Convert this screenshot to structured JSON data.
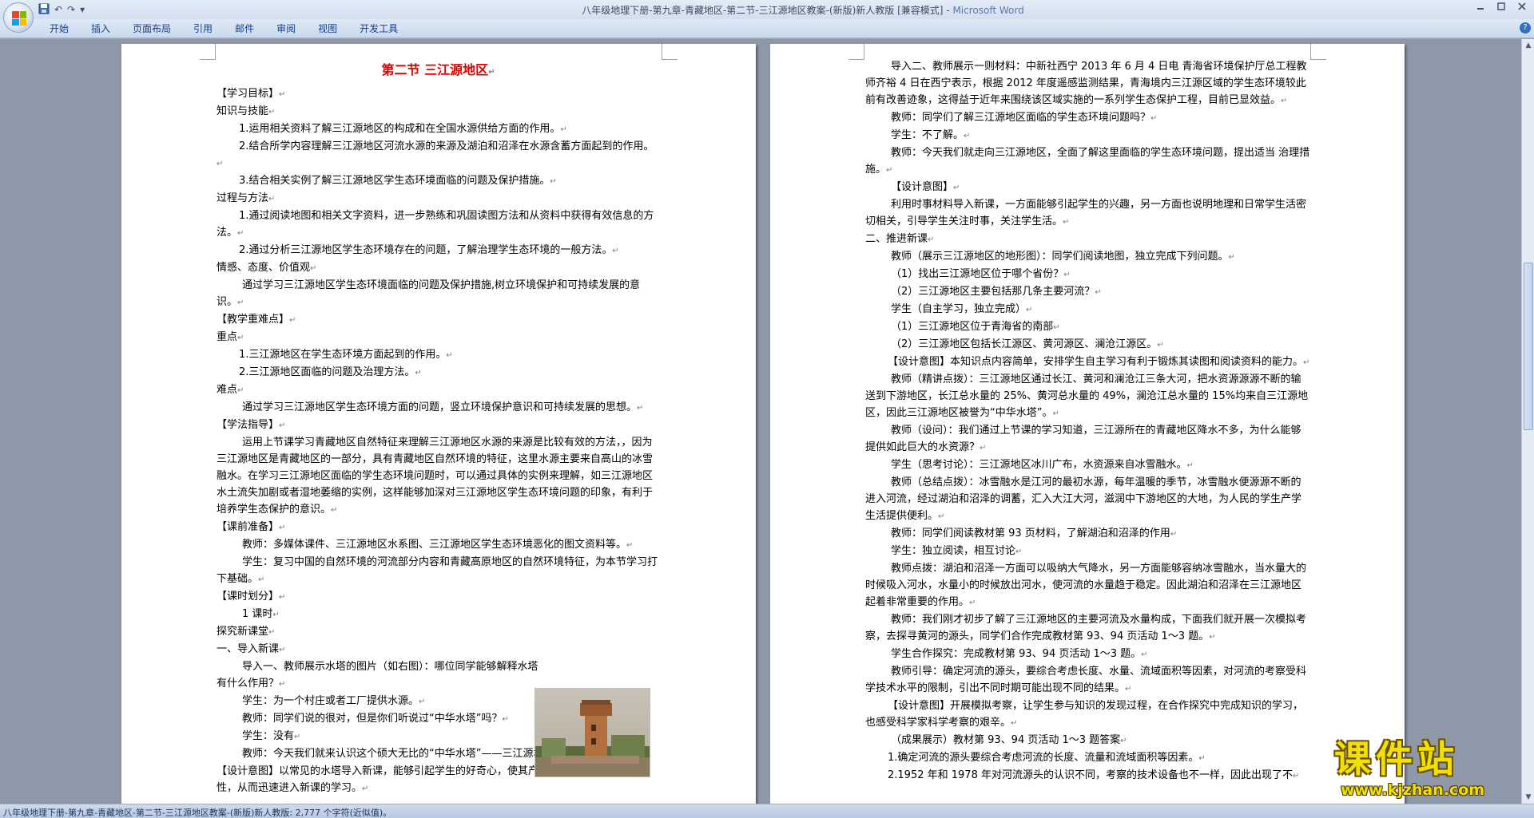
{
  "window": {
    "title_doc": "八年级地理下册-第九章-青藏地区-第二节-三江源地区教案-(新版)新人教版 [兼容模式] - ",
    "title_app": "Microsoft Word"
  },
  "qat": {
    "save_icon": "save-icon",
    "undo_label": "↶",
    "redo_label": "↷",
    "menu_label": "▾"
  },
  "ribbon": {
    "tabs": [
      "开始",
      "插入",
      "页面布局",
      "引用",
      "邮件",
      "审阅",
      "视图",
      "开发工具"
    ]
  },
  "page1": {
    "title": "第二节  三江源地区",
    "lines": [
      "【学习目标】",
      "知识与技能",
      "1.运用相关资料了解三江源地区的构成和在全国水源供给方面的作用。",
      "2.结合所学内容理解三江源地区河流水源的来源及湖泊和沼泽在水源含蓄方面起到的作用。",
      "3.结合相关实例了解三江源地区学生态环境面临的问题及保护措施。",
      "过程与方法",
      "1.通过阅读地图和相关文字资料，进一步熟练和巩固读图方法和从资料中获得有效信息的方法。",
      "2.通过分析三江源地区学生态环境存在的问题，了解治理学生态环境的一般方法。",
      "情感、态度、价值观",
      "通过学习三江源地区学生态环境面临的问题及保护措施,树立环境保护和可持续发展的意识。",
      "【教学重难点】",
      "重点",
      "1.三江源地区在学生态环境方面起到的作用。",
      "2.三江源地区面临的问题及治理方法。",
      "难点",
      "通过学习三江源地区学生态环境方面的问题，竖立环境保护意识和可持续发展的思想。",
      "【学法指导】",
      "运用上节课学习青藏地区自然特征来理解三江源地区水源的来源是比较有效的方法，，因为三江源地区是青藏地区的一部分，具有青藏地区自然环境的特征，这里水源主要来自高山的冰雪融水。在学习三江源地区面临的学生态环境问题时，可以通过具体的实例来理解，如三江源地区水土流失加剧或者湿地萎缩的实例，这样能够加深对三江源地区学生态环境问题的印象，有利于培养学生态保护的意识。",
      "【课前准备】",
      "教师：多媒体课件、三江源地区水系图、三江源地区学生态环境恶化的图文资料等。",
      "学生：复习中国的自然环境的河流部分内容和青藏高原地区的自然环境特征，为本节学习打下基础。",
      "【课时划分】",
      "1 课时",
      "探究新课堂",
      "一、导入新课",
      "导入一、教师展示水塔的图片（如右图）：哪位同学能够解释水塔有什么作用？",
      "学生：为一个村庄或者工厂提供水源。",
      "教师：同学们说的很对，但是你们听说过“中华水塔”吗？",
      "学生：没有",
      "教师：今天我们就来认识这个硕大无比的“中华水塔”——三江源地区。",
      "【设计意图】以常见的水塔导入新课，能够引起学生的好奇心，使其产学生探索新知识的积极性，从而迅速进入新课的学习。"
    ]
  },
  "page2": {
    "lines": [
      "导入二、教师展示一则材料：中新社西宁 2013 年 6 月 4 日电  青海省环境保护厅总工程教师齐裕 4 日在西宁表示，根据 2012 年度遥感监测结果，青海境内三江源区域的学生态环境较此前有改善迹象，这得益于近年来围绕该区域实施的一系列学生态保护工程，目前已显效益。",
      "教师：同学们了解三江源地区面临的学生态环境问题吗？",
      "学生：不了解。",
      "教师：今天我们就走向三江源地区，全面了解这里面临的学生态环境问题，提出适当 治理措施。",
      "【设计意图】",
      "利用时事材料导入新课，一方面能够引起学生的兴趣，另一方面也说明地理和日常学生活密切相关，引导学生关注时事，关注学生活。",
      "二、推进新课",
      "教师（展示三江源地区的地形图）：同学们阅读地图，独立完成下列问题。",
      "（1）找出三江源地区位于哪个省份？",
      "（2）三江源地区主要包括那几条主要河流？",
      "学生（自主学习，独立完成）",
      "（1）三江源地区位于青海省的南部",
      "（2）三江源地区包括长江源区、黄河源区、澜沧江源区。",
      "【设计意图】本知识点内容简单，安排学生自主学习有利于锻炼其读图和阅读资料的能力。",
      "教师（精讲点拨）：三江源地区通过长江、黄河和澜沧江三条大河，把水资源源源不断的输送到下游地区，长江总水量的 25%、黄河总水量的 49%，澜沧江总水量的 15%均来自三江源地区，因此三江源地区被誉为“中华水塔”。",
      "教师（设问）：我们通过上节课的学习知道，三江源所在的青藏地区降水不多，为什么能够提供如此巨大的水资源？",
      "学生（思考讨论）：三江源地区冰川广布，水资源来自冰雪融水。",
      "教师（总结点拨）：冰雪融水是江河的最初水源，每年温暖的季节，冰雪融水便源源不断的进入河流，经过湖泊和沼泽的调蓄，汇入大江大河，滋润中下游地区的大地，为人民的学生产学生活提供便利。",
      "教师：同学们阅读教材第 93 页材料，了解湖泊和沼泽的作用",
      "学生：独立阅读，相互讨论",
      "教师点拨：湖泊和沼泽一方面可以吸纳大气降水，另一方面能够容纳冰雪融水，当水量大的时候吸入河水，水量小的时候放出河水，使河流的水量趋于稳定。因此湖泊和沼泽在三江源地区起着非常重要的作用。",
      "教师：我们刚才初步了解了三江源地区的主要河流及水量构成，下面我们就开展一次模拟考察，去探寻黄河的源头，同学们合作完成教材第 93、94 页活动 1～3 题。",
      "学生合作探究：完成教材第 93、94 页活动 1～3 题。",
      "教师引导：确定河流的源头，要综合考虑长度、水量、流域面积等因素，对河流的考察受科学技术水平的限制，引出不同时期可能出现不同的结果。",
      "【设计意图】开展模拟考察，让学生参与知识的发现过程，在合作探究中完成知识的学习，也感受科学家科学考察的艰辛。",
      "（成果展示）教材第 93、94 页活动 1～3 题答案",
      "1.确定河流的源头要综合考虑河流的长度、流量和流域面积等因素。",
      "2.1952 年和 1978 年对河流源头的认识不同，考察的技术设备也不一样，因此出现了不"
    ]
  },
  "status": {
    "text": "八年级地理下册-第九章-青藏地区-第二节-三江源地区教案-(新版)新人教版: 2,777 个字符(近似值)。"
  },
  "watermark": {
    "big": "课件站",
    "url": "www.kjzhan.com"
  },
  "colors": {
    "title_red": "#e00000",
    "ribbon_text": "#15428b",
    "watermark_yellow": "#f2e100"
  }
}
